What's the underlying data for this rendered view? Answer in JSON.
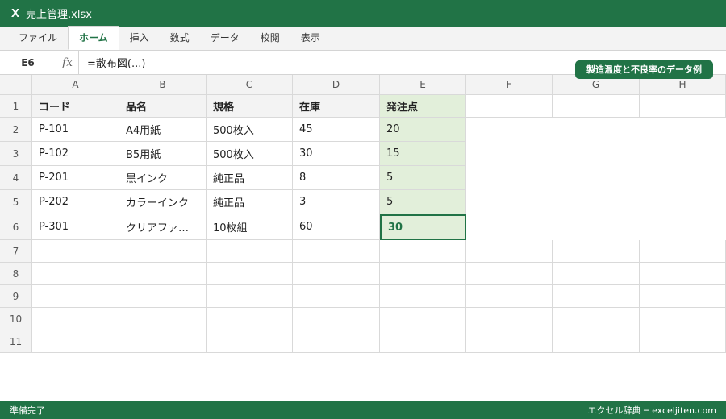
{
  "window": {
    "app_icon": "X",
    "title": "売上管理.xlsx"
  },
  "ribbon": {
    "tabs": [
      "ファイル",
      "ホーム",
      "挿入",
      "数式",
      "データ",
      "校閲",
      "表示"
    ],
    "active": 1
  },
  "formula_bar": {
    "name_box": "E6",
    "fx_label": "fx",
    "formula": "=散布図(...)"
  },
  "badge": "製造温度と不良率のデータ例",
  "sheet": {
    "columns": [
      "A",
      "B",
      "C",
      "D",
      "E",
      "F",
      "G",
      "H"
    ],
    "row_numbers": [
      "1",
      "2",
      "3",
      "4",
      "5",
      "6",
      "7",
      "8",
      "9",
      "10",
      "11"
    ],
    "header": [
      "コード",
      "品名",
      "規格",
      "在庫",
      "発注点"
    ],
    "rows": [
      [
        "P-101",
        "A4用紙",
        "500枚入",
        "45",
        "20"
      ],
      [
        "P-102",
        "B5用紙",
        "500枚入",
        "30",
        "15"
      ],
      [
        "P-201",
        "黒インク",
        "純正品",
        "8",
        "5"
      ],
      [
        "P-202",
        "カラーインク",
        "純正品",
        "3",
        "5"
      ],
      [
        "P-301",
        "クリアファ…",
        "10枚組",
        "60",
        "30"
      ]
    ],
    "selected_cell": "E6"
  },
  "status": {
    "left": "準備完了",
    "right": "エクセル辞典 ─ exceljiten.com"
  },
  "colors": {
    "accent": "#217346",
    "highlight": "#e2efda"
  }
}
